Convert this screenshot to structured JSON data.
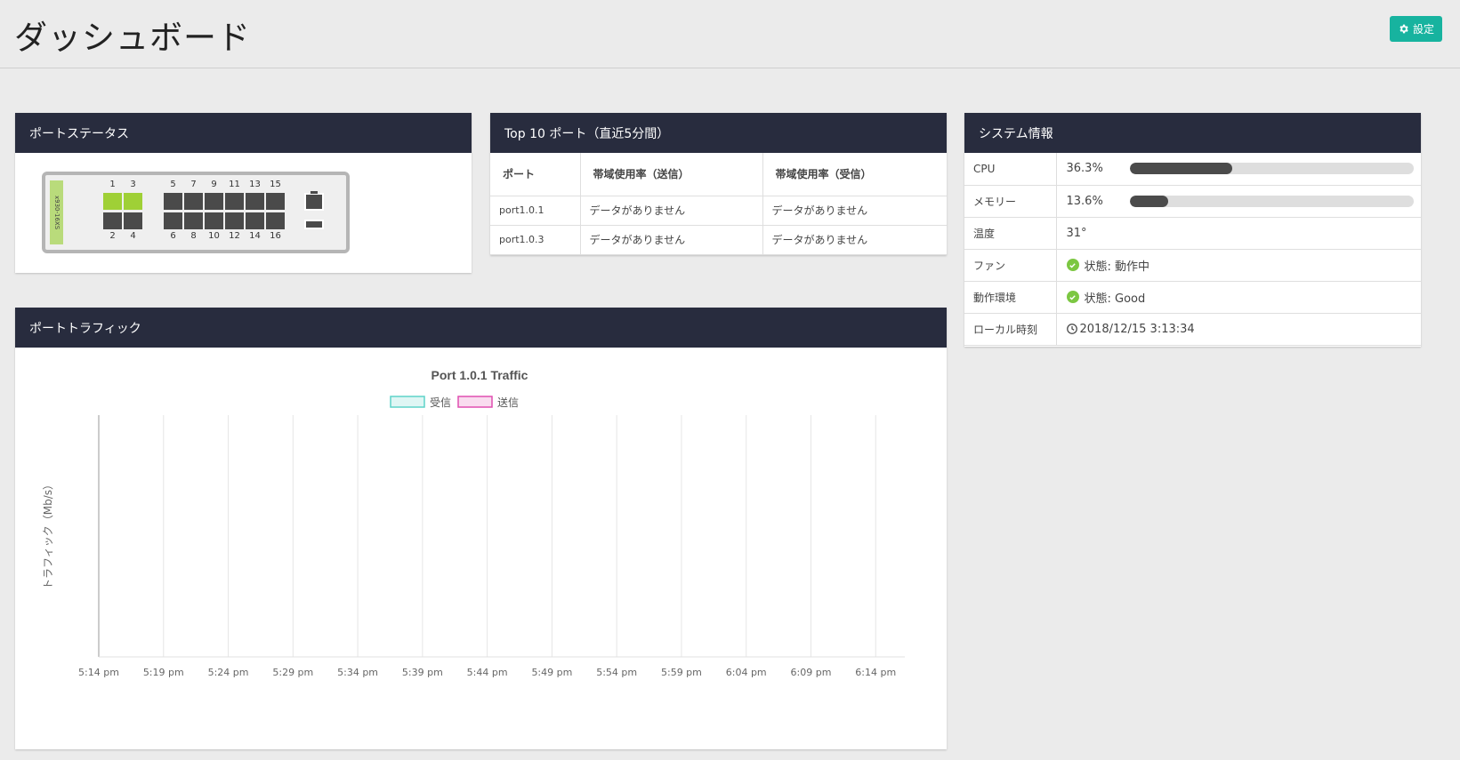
{
  "header": {
    "title": "ダッシュボード",
    "settings_label": "設定"
  },
  "colors": {
    "accent": "#17b39f",
    "panel_header": "#282c3e",
    "port_up": "#9fd036",
    "port_down": "#4a4a4a",
    "ok": "#7cc742",
    "rx": "#5fd3c9",
    "tx": "#e04fb0"
  },
  "port_status": {
    "title": "ポートステータス",
    "model": "x930-16XS",
    "ports": [
      {
        "num": "1",
        "status": "up"
      },
      {
        "num": "2",
        "status": "down"
      },
      {
        "num": "3",
        "status": "up"
      },
      {
        "num": "4",
        "status": "down"
      },
      {
        "num": "5",
        "status": "down"
      },
      {
        "num": "6",
        "status": "down"
      },
      {
        "num": "7",
        "status": "down"
      },
      {
        "num": "8",
        "status": "down"
      },
      {
        "num": "9",
        "status": "down"
      },
      {
        "num": "10",
        "status": "down"
      },
      {
        "num": "11",
        "status": "down"
      },
      {
        "num": "12",
        "status": "down"
      },
      {
        "num": "13",
        "status": "down"
      },
      {
        "num": "14",
        "status": "down"
      },
      {
        "num": "15",
        "status": "down"
      },
      {
        "num": "16",
        "status": "down"
      }
    ]
  },
  "top10": {
    "title": "Top 10 ポート（直近5分間）",
    "columns": [
      "ポート",
      "帯域使用率（送信）",
      "帯域使用率（受信）"
    ],
    "rows": [
      [
        "port1.0.1",
        "データがありません",
        "データがありません"
      ],
      [
        "port1.0.3",
        "データがありません",
        "データがありません"
      ]
    ]
  },
  "system_info": {
    "title": "システム情報",
    "cpu": {
      "label": "CPU",
      "value": "36.3%",
      "level": 0.363
    },
    "memory": {
      "label": "メモリー",
      "value": "13.6%",
      "level": 0.136
    },
    "temperature": {
      "label": "温度",
      "value": "31°"
    },
    "fan": {
      "label": "ファン",
      "value": "状態: 動作中"
    },
    "environment": {
      "label": "動作環境",
      "value": "状態: Good"
    },
    "local_time": {
      "label": "ローカル時刻",
      "value": "2018/12/15 3:13:34"
    }
  },
  "traffic": {
    "title": "ポートトラフィック"
  },
  "chart_data": {
    "type": "line",
    "title": "Port 1.0.1 Traffic",
    "ylabel": "トラフィック（Mb/s）",
    "xlabel": "",
    "x": [
      "5:14 pm",
      "5:19 pm",
      "5:24 pm",
      "5:29 pm",
      "5:34 pm",
      "5:39 pm",
      "5:44 pm",
      "5:49 pm",
      "5:54 pm",
      "5:59 pm",
      "6:04 pm",
      "6:09 pm",
      "6:14 pm"
    ],
    "series": [
      {
        "name": "受信",
        "values": [],
        "color": "#5fd3c9"
      },
      {
        "name": "送信",
        "values": [],
        "color": "#e04fb0"
      }
    ],
    "legend": "top",
    "grid": true
  }
}
